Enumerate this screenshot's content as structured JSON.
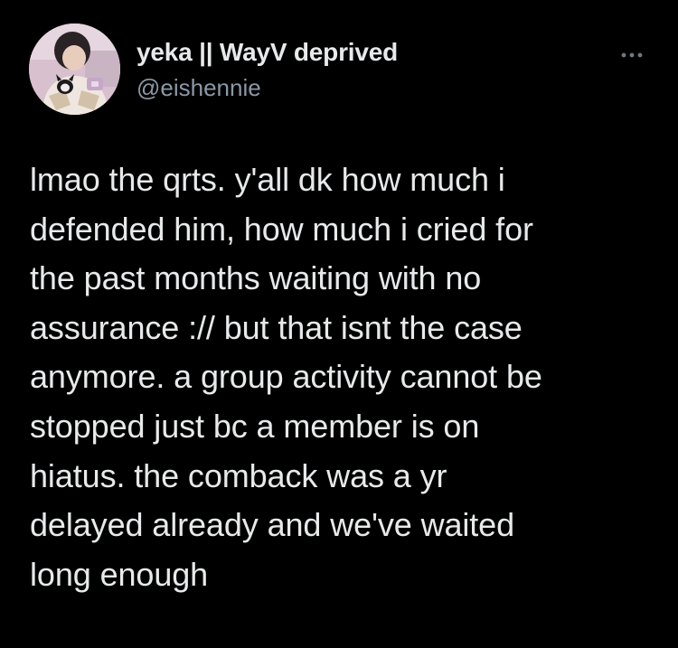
{
  "user": {
    "display_name": "yeka || WayV deprived",
    "handle": "@eishennie"
  },
  "tweet": {
    "text": "lmao the qrts. y'all dk how much i\ndefended him, how much i cried for\nthe past months waiting with no\nassurance :// but that isnt the case\nanymore. a group activity cannot be\nstopped just bc a member is on\nhiatus. the comback was a yr\ndelayed already and we've waited\nlong enough"
  },
  "icons": {
    "avatar": "profile-photo",
    "more": "more-horizontal-icon"
  },
  "colors": {
    "background": "#000000",
    "primary_text": "#e7e9ea",
    "secondary_text": "#8b98a5"
  }
}
